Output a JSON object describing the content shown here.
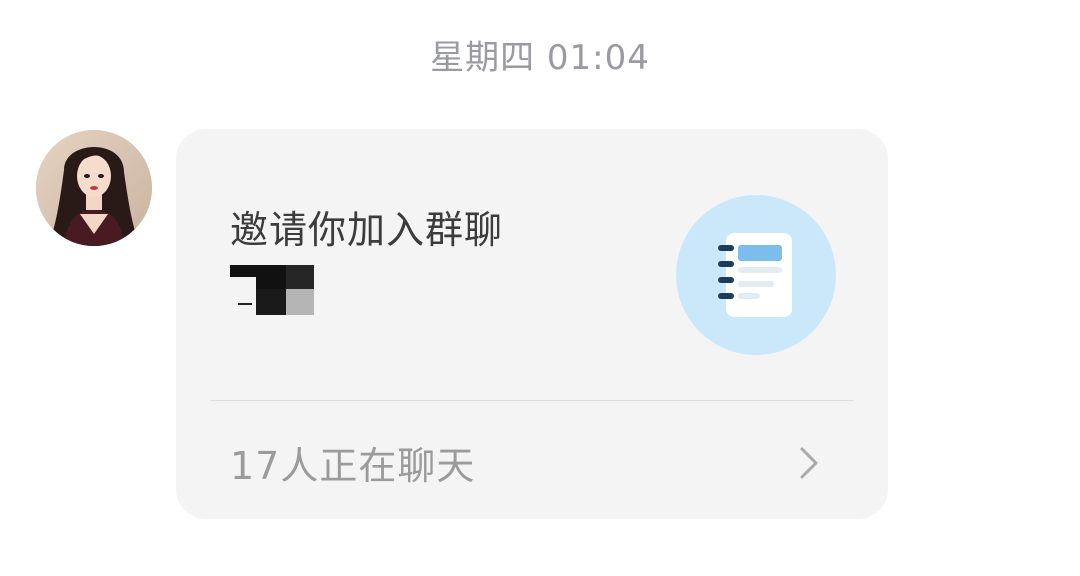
{
  "chat": {
    "timestamp": "星期四 01:04"
  },
  "message": {
    "sender_avatar": "avatar-woman-long-dark-hair",
    "invite_card": {
      "title": "邀请你加入群聊",
      "group_name_display": "redacted-name-image",
      "icon": "notebook-icon",
      "icon_bg_color": "#cbe8fb",
      "footer_text": "17人正在聊天",
      "chevron": "chevron-right-icon"
    }
  }
}
